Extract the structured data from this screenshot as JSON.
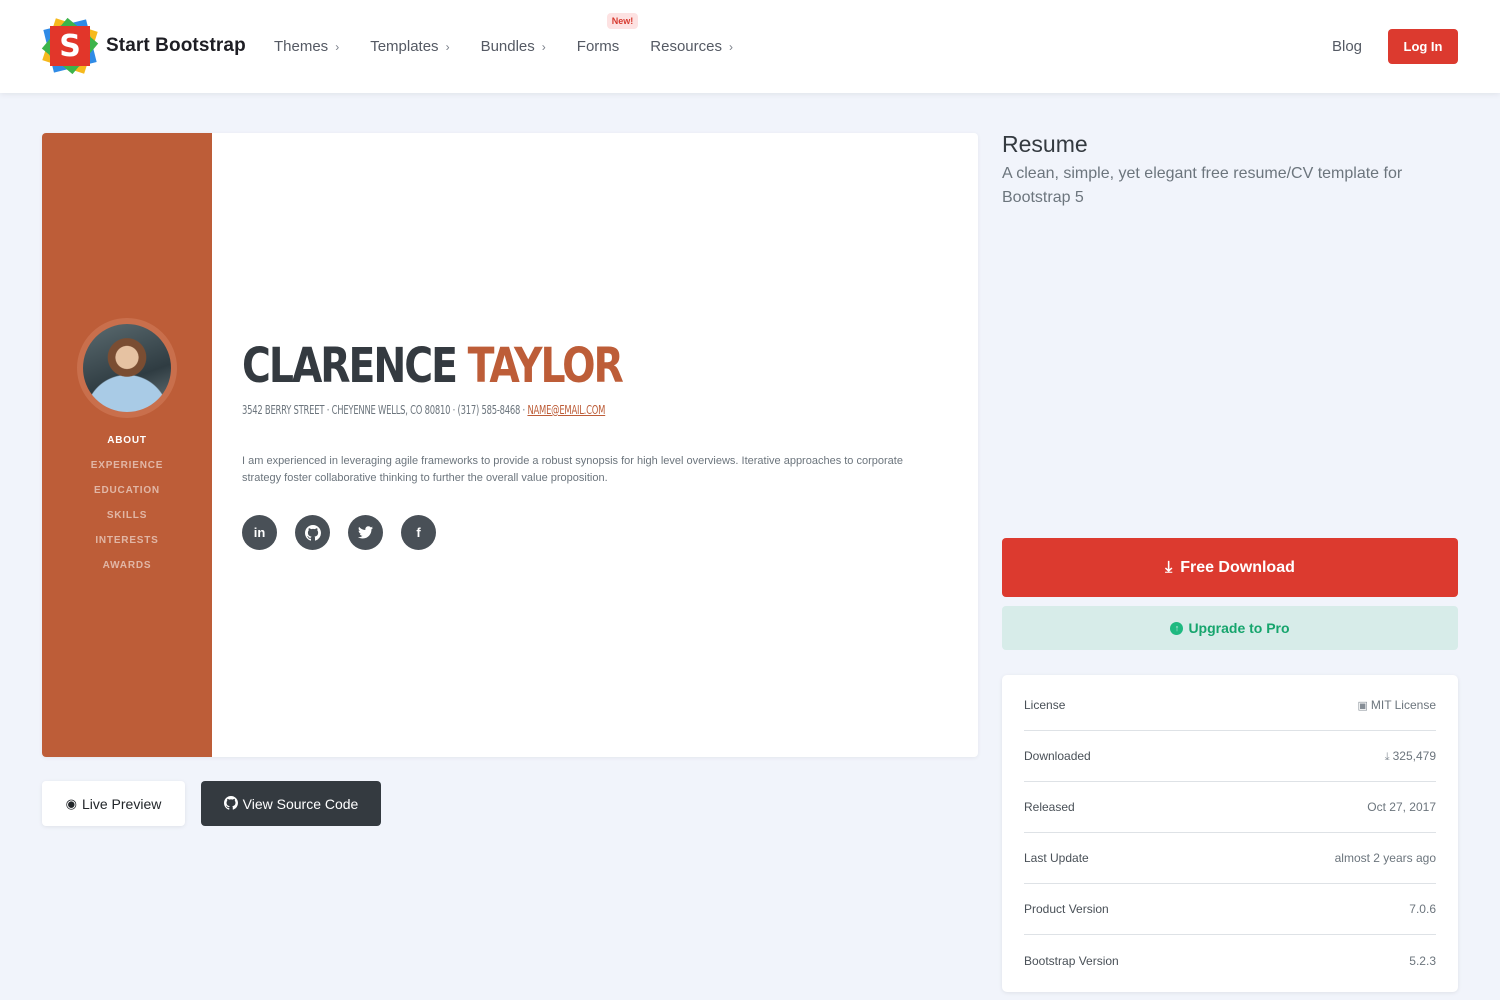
{
  "navbar": {
    "brand_letter": "S",
    "brand_name": "Start Bootstrap",
    "links": [
      {
        "label": "Themes",
        "has_chevron": true
      },
      {
        "label": "Templates",
        "has_chevron": true
      },
      {
        "label": "Bundles",
        "has_chevron": true
      },
      {
        "label": "Forms",
        "has_chevron": false,
        "badge": "New!"
      },
      {
        "label": "Resources",
        "has_chevron": true
      }
    ],
    "blog_label": "Blog",
    "login_label": "Log In"
  },
  "preview": {
    "sidebar_nav": [
      "About",
      "Experience",
      "Education",
      "Skills",
      "Interests",
      "Awards"
    ],
    "first_name": "CLARENCE",
    "last_name": "TAYLOR",
    "address": "3542 BERRY STREET · CHEYENNE WELLS, CO 80810 · (317) 585-8468 · ",
    "email": "NAME@EMAIL.COM",
    "intro": "I am experienced in leveraging agile frameworks to provide a robust synopsis for high level overviews. Iterative approaches to corporate strategy foster collaborative thinking to further the overall value proposition.",
    "socials": [
      "linkedin-icon",
      "github-icon",
      "twitter-icon",
      "facebook-icon"
    ],
    "accent_color": "#bd5d38"
  },
  "actions": {
    "live_preview": "Live Preview",
    "view_source": "View Source Code"
  },
  "product": {
    "title": "Resume",
    "subtitle": "A clean, simple, yet elegant free resume/CV template for Bootstrap 5",
    "download_label": "Free Download",
    "upgrade_label": "Upgrade to Pro",
    "info": [
      {
        "label": "License",
        "value": "MIT License",
        "icon": "license-icon"
      },
      {
        "label": "Downloaded",
        "value": "325,479",
        "icon": "download-icon"
      },
      {
        "label": "Released",
        "value": "Oct 27, 2017"
      },
      {
        "label": "Last Update",
        "value": "almost 2 years ago"
      },
      {
        "label": "Product Version",
        "value": "7.0.6"
      },
      {
        "label": "Bootstrap Version",
        "value": "5.2.3"
      }
    ]
  },
  "colors": {
    "brand_red": "#dc3a2f",
    "pro_green": "#16a56d",
    "page_bg": "#f1f4fb"
  }
}
